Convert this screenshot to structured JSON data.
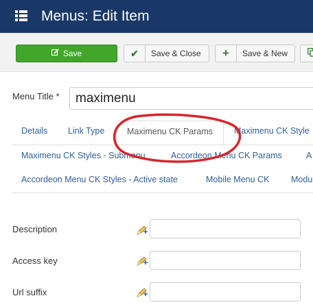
{
  "header": {
    "title": "Menus: Edit Item",
    "icon": "menu-list-icon"
  },
  "toolbar": {
    "save_label": "Save",
    "save_close_label": "Save & Close",
    "save_new_label": "Save & New"
  },
  "menu_title": {
    "label": "Menu Title *",
    "value": "maximenu"
  },
  "tabs": {
    "row1": [
      "Details",
      "Link Type",
      "Maximenu CK Params",
      "Maximenu CK Style"
    ],
    "row2": [
      "Maximenu CK Styles - Submenu",
      "Accordeon Menu CK Params",
      "A"
    ],
    "row3": [
      "Accordeon Menu CK Styles - Active state",
      "Mobile Menu CK",
      "Modu"
    ],
    "active": "Maximenu CK Params"
  },
  "fields": [
    {
      "label": "Description",
      "value": ""
    },
    {
      "label": "Access key",
      "value": ""
    },
    {
      "label": "Url suffix",
      "value": ""
    }
  ],
  "colors": {
    "header_bg": "#1a3867",
    "save_green": "#41a62a",
    "link_blue": "#2f5f9c",
    "annotation_red": "#d9252a"
  }
}
